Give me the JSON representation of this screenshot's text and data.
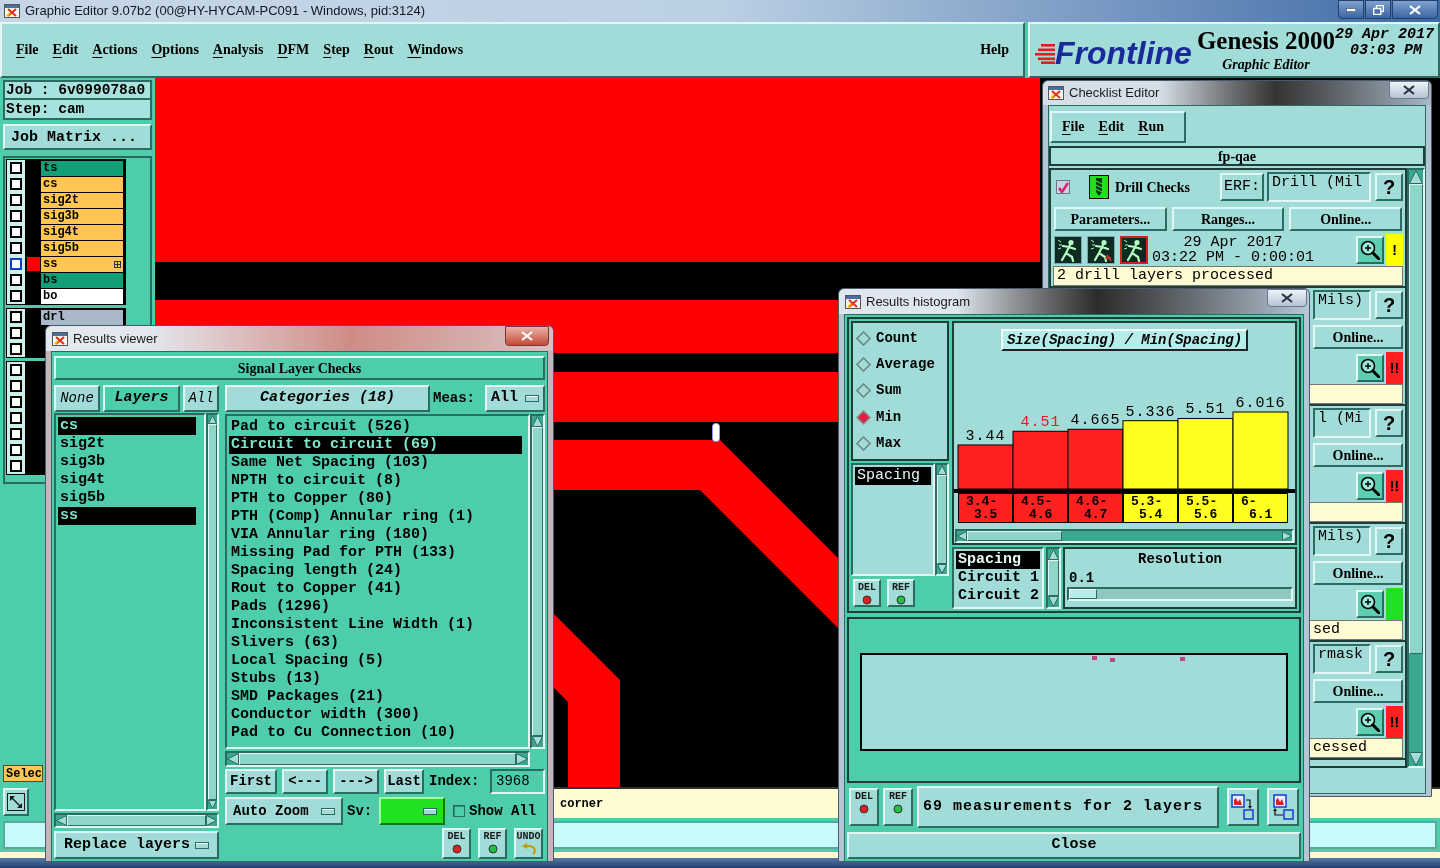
{
  "window": {
    "title": "Graphic Editor 9.07b2 (00@HY-HYCAM-PC091 - Windows, pid:3124)"
  },
  "menu": [
    "File",
    "Edit",
    "Actions",
    "Options",
    "Analysis",
    "DFM",
    "Step",
    "Rout",
    "Windows"
  ],
  "help_menu": "Help",
  "branding": {
    "logo": "Frontline",
    "product": "Genesis 2000",
    "subtitle": "Graphic Editor",
    "date": "29 Apr 2017",
    "time": "03:03 PM"
  },
  "job_panel": {
    "job": "Job : 6v099078a0",
    "step": "Step: cam",
    "matrix_button": "Job Matrix ...",
    "layer_groups": [
      {
        "layers": [
          {
            "name": "ts",
            "color": "#12a07a",
            "checked": false,
            "work": false
          },
          {
            "name": "cs",
            "color": "#ffc652",
            "checked": false,
            "work": false
          },
          {
            "name": "sig2t",
            "color": "#ffc652",
            "checked": false,
            "work": false
          },
          {
            "name": "sig3b",
            "color": "#ffc652",
            "checked": false,
            "work": false
          },
          {
            "name": "sig4t",
            "color": "#ffc652",
            "checked": false,
            "work": false
          },
          {
            "name": "sig5b",
            "color": "#ffc652",
            "checked": false,
            "work": false
          },
          {
            "name": "ss",
            "color": "#ffc652",
            "checked": false,
            "work": true
          },
          {
            "name": "bs",
            "color": "#12a07a",
            "checked": false,
            "work": false
          },
          {
            "name": "bo",
            "color": "#ffffff",
            "checked": false,
            "work": false
          }
        ]
      },
      {
        "layers": [
          {
            "name": "drl",
            "color": "#a9b9c9",
            "checked": false,
            "work": false
          },
          {
            "checked": false
          },
          {
            "checked": false
          }
        ]
      },
      {
        "layers": [
          {
            "checked": false
          },
          {
            "checked": false
          },
          {
            "checked": false
          },
          {
            "checked": false
          },
          {
            "checked": false
          },
          {
            "checked": false
          },
          {
            "checked": false
          }
        ]
      }
    ],
    "select_button": "Selec"
  },
  "status_bar": {
    "message": "corner"
  },
  "checklist_editor": {
    "title": "Checklist Editor",
    "menu": [
      "File",
      "Edit",
      "Run"
    ],
    "checklist_name": "fp-qae",
    "checks": [
      {
        "kind": "full",
        "checked": true,
        "name": "Drill Checks",
        "erf_label": "ERF:",
        "erf_value": "Drill (Mil",
        "help": "?",
        "buttons": [
          "Parameters...",
          "Ranges...",
          "Online..."
        ],
        "date": "29 Apr 2017",
        "time": "03:22 PM - 0:00:01",
        "color": "#ffff00",
        "result_mark": "!",
        "message": "2 drill layers processed"
      },
      {
        "kind": "strip",
        "erf_value": "Mils)",
        "help": "?",
        "buttons": [
          "Online..."
        ],
        "color": "#ff2020",
        "result_mark": "!!"
      },
      {
        "kind": "strip",
        "erf_value": "l (Mi",
        "help": "?",
        "buttons": [
          "Online..."
        ],
        "color": "#ff2020",
        "result_mark": "!!"
      },
      {
        "kind": "strip",
        "erf_value": "Mils)",
        "help": "?",
        "buttons": [
          "Online..."
        ],
        "color": "#20e020",
        "message": "sed"
      },
      {
        "kind": "strip",
        "erf_value": "rmask",
        "help": "?",
        "buttons": [
          "Online..."
        ],
        "color": "#ff2020",
        "result_mark": "!!",
        "message": "cessed"
      }
    ]
  },
  "results_histogram": {
    "title": "Results histogram",
    "modes": [
      {
        "label": "Count",
        "selected": false
      },
      {
        "label": "Average",
        "selected": false
      },
      {
        "label": "Sum",
        "selected": false
      },
      {
        "label": "Min",
        "selected": true
      },
      {
        "label": "Max",
        "selected": false
      }
    ],
    "measures": [
      {
        "label": "Spacing",
        "selected": true
      }
    ],
    "side_buttons": [
      {
        "label": "DEL",
        "kind": "delete"
      },
      {
        "label": "REF",
        "kind": "refresh"
      }
    ],
    "chart_data": {
      "type": "bar",
      "title": "Size(Spacing) / Min(Spacing)",
      "categories": [
        "3.4-3.5",
        "4.5-4.6",
        "4.6-4.7",
        "5.3-5.4",
        "5.5-5.6",
        "6-6.1"
      ],
      "series": [
        {
          "color": "#ff2020",
          "values": [
            3.44,
            4.51,
            4.665,
            null,
            null,
            null
          ]
        },
        {
          "color": "#ffff20",
          "values": [
            null,
            null,
            null,
            5.336,
            5.51,
            6.016
          ]
        }
      ],
      "stacked": true,
      "data_labels": true
    },
    "bins": [
      {
        "selected": false
      },
      {
        "selected": true
      },
      {
        "selected": false
      },
      {
        "selected": false
      },
      {
        "selected": false
      },
      {
        "selected": false
      }
    ],
    "filters": [
      {
        "label": "Spacing",
        "selected": true
      },
      {
        "label": "Circuit 1",
        "selected": false
      },
      {
        "label": "Circuit 2",
        "selected": false
      }
    ],
    "resolution": {
      "label": "Resolution",
      "value": "0.1",
      "level": 0
    },
    "footer_buttons": [
      {
        "label": "DEL",
        "kind": "delete"
      },
      {
        "label": "REF",
        "kind": "refresh"
      }
    ],
    "summary": "69 measurements for 2 layers",
    "close_button": "Close"
  },
  "results_viewer": {
    "title": "Results viewer",
    "heading": "Signal Layer Checks",
    "layer_buttons": [
      {
        "label": "None",
        "kind": "plain"
      },
      {
        "label": "Layers",
        "kind": "title"
      },
      {
        "label": "All",
        "kind": "plain"
      }
    ],
    "layers": [
      {
        "name": "cs",
        "selected": true
      },
      {
        "name": "sig2t",
        "selected": false
      },
      {
        "name": "sig3b",
        "selected": false
      },
      {
        "name": "sig4t",
        "selected": false
      },
      {
        "name": "sig5b",
        "selected": false
      },
      {
        "name": "ss",
        "selected": true
      }
    ],
    "replace_menu": "Replace layers",
    "categories_button": "Categories (18)",
    "meas_label": "Meas:",
    "meas_value": "All",
    "categories": [
      {
        "label": "Pad to circuit (526)",
        "selected": false
      },
      {
        "label": "Circuit to circuit (69)",
        "selected": true
      },
      {
        "label": "Same Net Spacing (103)",
        "selected": false
      },
      {
        "label": "NPTH to circuit (8)",
        "selected": false
      },
      {
        "label": "PTH to Copper (80)",
        "selected": false
      },
      {
        "label": "PTH (Comp) Annular ring (1)",
        "selected": false
      },
      {
        "label": "VIA Annular ring (180)",
        "selected": false
      },
      {
        "label": "Missing Pad for PTH (133)",
        "selected": false
      },
      {
        "label": "Spacing length (24)",
        "selected": false
      },
      {
        "label": "Rout to Copper (41)",
        "selected": false
      },
      {
        "label": "Pads (1296)",
        "selected": false
      },
      {
        "label": "Inconsistent Line Width (1)",
        "selected": false
      },
      {
        "label": "Slivers (63)",
        "selected": false
      },
      {
        "label": "Local Spacing (5)",
        "selected": false
      },
      {
        "label": "Stubs (13)",
        "selected": false
      },
      {
        "label": "SMD Packages (21)",
        "selected": false
      },
      {
        "label": "Conductor width (300)",
        "selected": false
      },
      {
        "label": "Pad to Cu Connection (10)",
        "selected": false
      }
    ],
    "nav_buttons": [
      "First",
      "<---",
      "--->",
      "Last"
    ],
    "index_label": "Index:",
    "index_value": "3968",
    "zoom_menu": "Auto Zoom",
    "sv_label": "Sv:",
    "show_all": {
      "label": "Show All",
      "checked": false
    },
    "action_buttons": [
      {
        "label": "DEL",
        "kind": "delete"
      },
      {
        "label": "REF",
        "kind": "refresh"
      },
      {
        "label": "UNDO",
        "kind": "undo"
      }
    ]
  }
}
